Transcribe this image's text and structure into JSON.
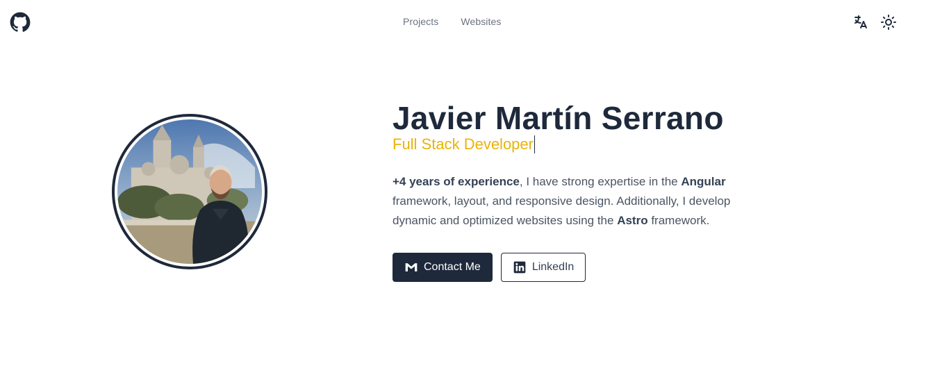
{
  "header": {
    "github_icon": "github-icon",
    "nav": [
      {
        "label": "Projects"
      },
      {
        "label": "Websites"
      }
    ],
    "translate_icon": "translate-icon",
    "theme_icon": "sun-icon"
  },
  "hero": {
    "name": "Javier Martín Serrano",
    "role": "Full Stack Developer",
    "bio": {
      "p1_bold": "+4 years of experience",
      "p1_text": ", I have strong expertise in the ",
      "p2_bold": "Angular",
      "p2_text": " framework, layout, and responsive design. Additionally, I develop dynamic and optimized websites using the ",
      "p3_bold": "Astro",
      "p3_text": " framework."
    },
    "buttons": {
      "contact": "Contact Me",
      "linkedin": "LinkedIn"
    }
  },
  "colors": {
    "primary": "#1e293b",
    "accent": "#eab308",
    "muted": "#6b7280"
  }
}
